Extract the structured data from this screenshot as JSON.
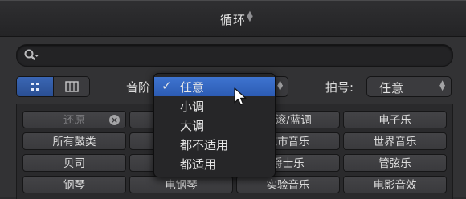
{
  "header": {
    "title": "循环"
  },
  "search": {
    "placeholder": ""
  },
  "filters": {
    "scale_label": "音阶",
    "signature_label": "拍号:",
    "signature_value": "任意"
  },
  "scale_menu": {
    "items": [
      "任意",
      "小调",
      "大调",
      "都不适用",
      "都适用"
    ],
    "selected_index": 0
  },
  "keyword_buttons": [
    [
      "还原",
      "",
      "摇滚/蓝调",
      "电子乐"
    ],
    [
      "所有鼓类",
      "",
      "城市音乐",
      "世界音乐"
    ],
    [
      "贝司",
      "",
      "爵士乐",
      "管弦乐"
    ],
    [
      "钢琴",
      "电钢琴",
      "实验音乐",
      "电影音效"
    ]
  ],
  "colors": {
    "accent": "#2f5fb5",
    "background": "#323234"
  }
}
